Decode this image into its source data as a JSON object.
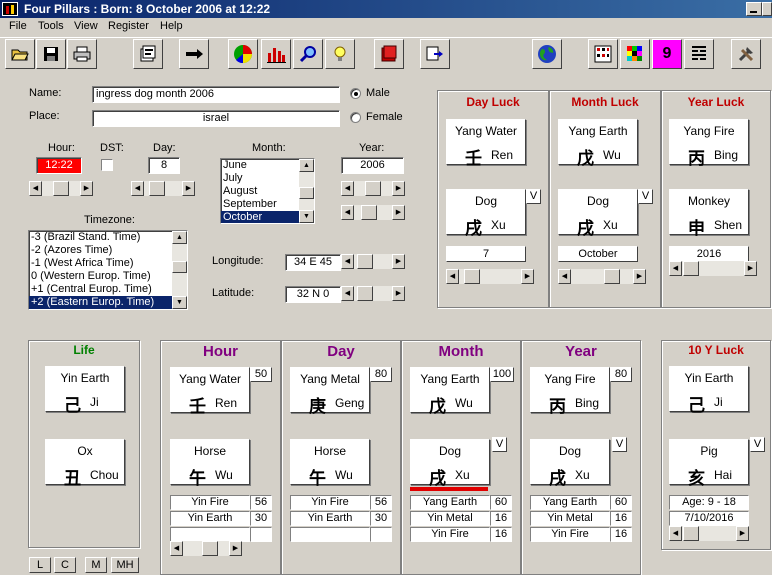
{
  "window": {
    "title": "Four Pillars :  Born:  8 October 2006 at 12:22"
  },
  "menu": [
    "File",
    "Tools",
    "View",
    "Register",
    "Help"
  ],
  "toolbar": [
    "open-folder-icon",
    "save-disk-icon",
    "print-icon",
    "properties-icon",
    "arrow-right-icon",
    "pie-chart-icon",
    "bar-chart-icon",
    "magnifier-icon",
    "lightbulb-icon",
    "book-icon",
    "export-icon",
    "globe-icon",
    "grid-calendar-icon",
    "color-grid-icon",
    "nine-icon",
    "lines-icon",
    "tools-icon"
  ],
  "toolbar_nine": "9",
  "form": {
    "name_label": "Name:",
    "name_value": "ingress dog month 2006",
    "place_label": "Place:",
    "place_value": "israel",
    "male_label": "Male",
    "female_label": "Female",
    "hour_label": "Hour:",
    "hour_value": "12:22",
    "dst_label": "DST:",
    "day_label": "Day:",
    "day_value": "8",
    "month_label": "Month:",
    "months": [
      "June",
      "July",
      "August",
      "September",
      "October"
    ],
    "month_selected": "October",
    "year_label": "Year:",
    "year_value": "2006",
    "timezone_label": "Timezone:",
    "timezones": [
      "-3 (Brazil Stand.  Time)",
      "-2 (Azores Time)",
      "-1 (West Africa Time)",
      "0 (Western Europ. Time)",
      "+1 (Central Europ. Time)",
      "+2 (Eastern Europ. Time)"
    ],
    "timezone_selected": "+2 (Eastern Europ. Time)",
    "longitude_label": "Longitude:",
    "longitude_value": "34 E 45",
    "latitude_label": "Latitude:",
    "latitude_value": "32 N 0"
  },
  "luck": {
    "day": {
      "title": "Day Luck",
      "stem_en": "Yang Water",
      "stem_cn": "壬",
      "stem_py": "Ren",
      "branch_en": "Dog",
      "branch_cn": "戌",
      "branch_py": "Xu",
      "v": "V",
      "value": "7"
    },
    "month": {
      "title": "Month Luck",
      "stem_en": "Yang Earth",
      "stem_cn": "戊",
      "stem_py": "Wu",
      "branch_en": "Dog",
      "branch_cn": "戌",
      "branch_py": "Xu",
      "v": "V",
      "value": "October"
    },
    "year": {
      "title": "Year Luck",
      "stem_en": "Yang Fire",
      "stem_cn": "丙",
      "stem_py": "Bing",
      "branch_en": "Monkey",
      "branch_cn": "申",
      "branch_py": "Shen",
      "value": "2016"
    }
  },
  "life": {
    "title": "Life",
    "stem_en": "Yin Earth",
    "stem_cn": "己",
    "stem_py": "Ji",
    "branch_en": "Ox",
    "branch_cn": "丑",
    "branch_py": "Chou"
  },
  "pillars": [
    {
      "title": "Hour",
      "stem_en": "Yang Water",
      "stem_cn": "壬",
      "stem_py": "Ren",
      "score": "50",
      "branch_en": "Horse",
      "branch_cn": "午",
      "branch_py": "Wu",
      "hidden": [
        [
          "Yin Fire",
          "56"
        ],
        [
          "Yin Earth",
          "30"
        ],
        [
          "",
          ""
        ]
      ]
    },
    {
      "title": "Day",
      "stem_en": "Yang Metal",
      "stem_cn": "庚",
      "stem_py": "Geng",
      "score": "80",
      "branch_en": "Horse",
      "branch_cn": "午",
      "branch_py": "Wu",
      "hidden": [
        [
          "Yin Fire",
          "56"
        ],
        [
          "Yin Earth",
          "30"
        ],
        [
          "",
          ""
        ]
      ]
    },
    {
      "title": "Month",
      "stem_en": "Yang Earth",
      "stem_cn": "戊",
      "stem_py": "Wu",
      "score": "100",
      "branch_en": "Dog",
      "branch_cn": "戌",
      "branch_py": "Xu",
      "v": "V",
      "hidden": [
        [
          "Yang Earth",
          "60"
        ],
        [
          "Yin Metal",
          "16"
        ],
        [
          "Yin Fire",
          "16"
        ]
      ]
    },
    {
      "title": "Year",
      "stem_en": "Yang Fire",
      "stem_cn": "丙",
      "stem_py": "Bing",
      "score": "80",
      "branch_en": "Dog",
      "branch_cn": "戌",
      "branch_py": "Xu",
      "v": "V",
      "hidden": [
        [
          "Yang Earth",
          "60"
        ],
        [
          "Yin Metal",
          "16"
        ],
        [
          "Yin Fire",
          "16"
        ]
      ]
    }
  ],
  "ten_year": {
    "title": "10 Y Luck",
    "stem_en": "Yin Earth",
    "stem_cn": "己",
    "stem_py": "Ji",
    "branch_en": "Pig",
    "branch_cn": "亥",
    "branch_py": "Hai",
    "v": "V",
    "age": "Age: 9 - 18",
    "date": "7/10/2016"
  },
  "bottom_buttons": [
    "L",
    "C",
    "M",
    "MH"
  ],
  "colors": {
    "luck_title": "#c00000",
    "pillar_title": "#800080",
    "life_title": "#008000",
    "hour_bg": "#ff0000"
  }
}
